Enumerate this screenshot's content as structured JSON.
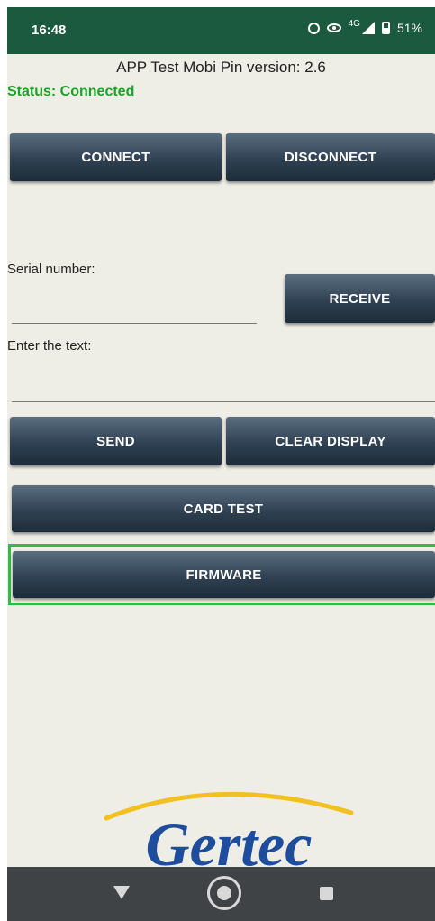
{
  "status_bar": {
    "time": "16:48",
    "network": "4G",
    "battery": "51%",
    "icons": [
      "alarm-icon",
      "eye-icon",
      "signal-icon",
      "battery-icon"
    ]
  },
  "app": {
    "title": "APP Test Mobi Pin version: 2.6",
    "status": "Status: Connected",
    "status_color": "#1aa229"
  },
  "buttons": {
    "connect": "CONNECT",
    "disconnect": "DISCONNECT",
    "receive": "RECEIVE",
    "send": "SEND",
    "clear_display": "CLEAR DISPLAY",
    "card_test": "CARD TEST",
    "firmware": "FIRMWARE"
  },
  "fields": {
    "serial_label": "Serial number:",
    "serial_value": "",
    "text_label": "Enter the text:",
    "text_value": ""
  },
  "logo": {
    "text": "Gertec",
    "color": "#1d4d9c",
    "arc_color": "#f2c020"
  },
  "nav": {
    "icons": [
      "back-icon",
      "home-icon",
      "recents-icon"
    ]
  },
  "colors": {
    "status_bar": "#1c5a3f",
    "button": "#2f4152",
    "focus_frame": "#2fbb45",
    "nav_bar": "#404346"
  }
}
